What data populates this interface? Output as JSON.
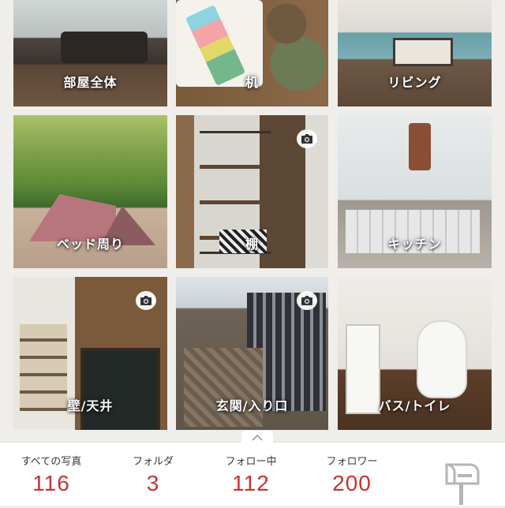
{
  "folders": [
    {
      "label": "部屋全体",
      "has_camera": false
    },
    {
      "label": "机",
      "has_camera": false
    },
    {
      "label": "リビング",
      "has_camera": false
    },
    {
      "label": "ベッド周り",
      "has_camera": false
    },
    {
      "label": "棚",
      "has_camera": true
    },
    {
      "label": "キッチン",
      "has_camera": false
    },
    {
      "label": "壁/天井",
      "has_camera": true
    },
    {
      "label": "玄関/入り口",
      "has_camera": true
    },
    {
      "label": "バス/トイレ",
      "has_camera": false
    }
  ],
  "stats": [
    {
      "label": "すべての写真",
      "value": "116"
    },
    {
      "label": "フォルダ",
      "value": "3"
    },
    {
      "label": "フォロー中",
      "value": "112"
    },
    {
      "label": "フォロワー",
      "value": "200"
    }
  ],
  "icons": {
    "camera": "camera-icon",
    "chevron": "chevron-up-icon",
    "mailbox": "mailbox-icon"
  },
  "colors": {
    "accent": "#c8322f",
    "background": "#efeeea"
  }
}
